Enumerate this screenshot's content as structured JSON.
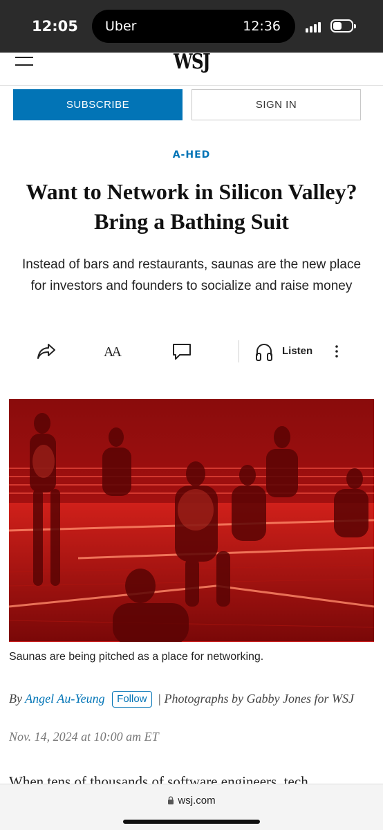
{
  "status_bar": {
    "time": "12:05",
    "live_activity_app": "Uber",
    "live_activity_time": "12:36"
  },
  "header": {
    "logo": "WSJ",
    "menu_icon": "hamburger-menu-icon"
  },
  "actions": {
    "subscribe_label": "SUBSCRIBE",
    "sign_in_label": "SIGN IN"
  },
  "article": {
    "flag": "A-HED",
    "headline": "Want to Network in Silicon Valley? Bring a Bathing Suit",
    "dek": "Instead of bars and restaurants, saunas are the new place for investors and founders to socialize and raise money",
    "toolbar": {
      "icons": [
        "share-icon",
        "text-size-icon",
        "comment-icon",
        "headphones-icon",
        "more-icon"
      ],
      "text_size_glyph": "AA",
      "listen_label": "Listen"
    },
    "image_caption": "Saunas are being pitched as a place for networking.",
    "byline": {
      "by": "By",
      "author": "Angel Au-Yeung",
      "follow_label": "Follow",
      "photo_credit": "| Photographs by Gabby Jones for WSJ"
    },
    "date": "Nov. 14, 2024 at 10:00 am ET",
    "body_start": "When tens of thousands of software engineers, tech"
  },
  "browser": {
    "url": "wsj.com"
  },
  "colors": {
    "accent": "#0274b6",
    "status_bar": "#2b2b2b",
    "photo_red": "#c41010"
  }
}
